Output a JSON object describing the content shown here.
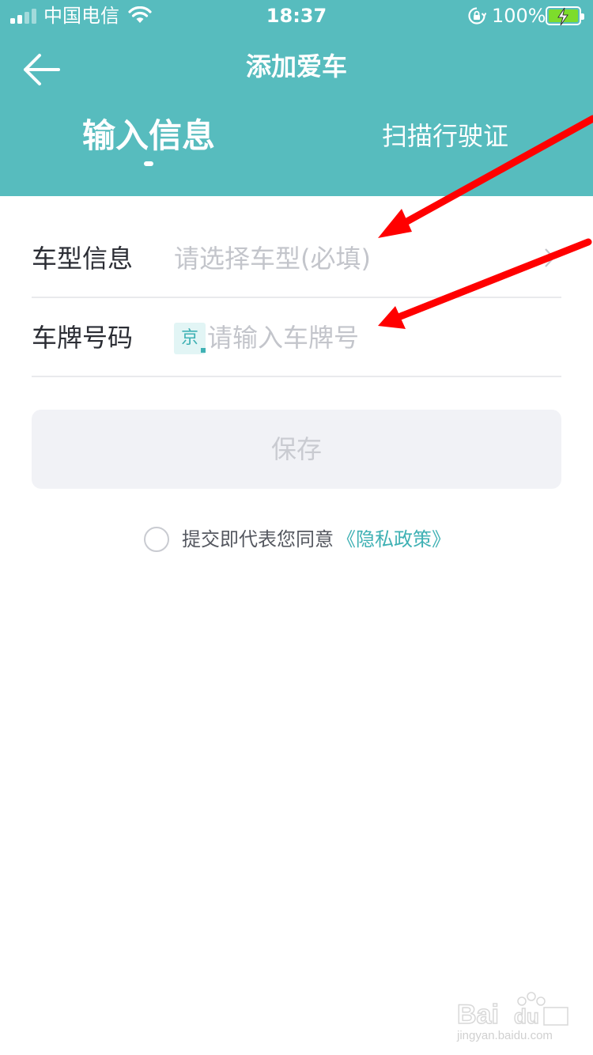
{
  "status_bar": {
    "carrier": "中国电信",
    "time": "18:37",
    "battery": "100%"
  },
  "nav": {
    "title": "添加爱车"
  },
  "tabs": [
    {
      "label": "输入信息",
      "active": true
    },
    {
      "label": "扫描行驶证",
      "active": false
    }
  ],
  "form": {
    "car_model": {
      "label": "车型信息",
      "placeholder": "请选择车型(必填)"
    },
    "plate": {
      "label": "车牌号码",
      "prefix": "京",
      "placeholder": "请输入车牌号"
    }
  },
  "save_label": "保存",
  "agreement": {
    "text": "提交即代表您同意",
    "link": "《隐私政策》"
  },
  "colors": {
    "header": "#57bcbe",
    "accent": "#3fb1b4",
    "annotation": "#ff0000"
  }
}
